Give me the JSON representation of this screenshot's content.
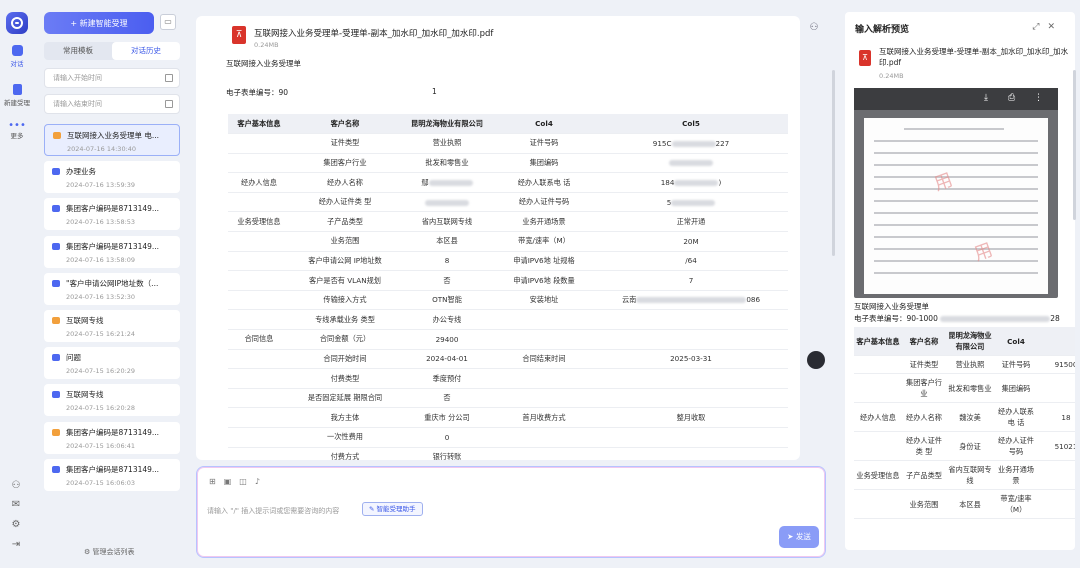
{
  "rail": {
    "items": [
      {
        "label": "对话",
        "active": true
      },
      {
        "label": "新建受理",
        "active": false
      },
      {
        "label": "更多",
        "active": false
      }
    ]
  },
  "sidebar": {
    "new_button": "+ 新建智能受理",
    "tabs": [
      {
        "label": "常用模板",
        "active": false
      },
      {
        "label": "对话历史",
        "active": true
      }
    ],
    "start_date_placeholder": "请输入开始时间",
    "end_date_placeholder": "请输入结束时间",
    "history": [
      {
        "title": "互联网接入业务受理单 电...",
        "date": "2024-07-16 14:30:40",
        "icon": "orange",
        "active": true
      },
      {
        "title": "办理业务",
        "date": "2024-07-16 13:59:39",
        "icon": "blue",
        "active": false
      },
      {
        "title": "集团客户编码是8713149...",
        "date": "2024-07-16 13:58:53",
        "icon": "blue",
        "active": false
      },
      {
        "title": "集团客户编码是8713149...",
        "date": "2024-07-16 13:58:09",
        "icon": "blue",
        "active": false
      },
      {
        "title": "\"客户申请公网IP地址数（...",
        "date": "2024-07-16 13:52:30",
        "icon": "blue",
        "active": false
      },
      {
        "title": "互联网专线",
        "date": "2024-07-15 16:21:24",
        "icon": "orange",
        "active": false
      },
      {
        "title": "问题",
        "date": "2024-07-15 16:20:29",
        "icon": "blue",
        "active": false
      },
      {
        "title": "互联网专线",
        "date": "2024-07-15 16:20:28",
        "icon": "blue",
        "active": false
      },
      {
        "title": "集团客户编码是8713149...",
        "date": "2024-07-15 16:06:41",
        "icon": "orange",
        "active": false
      },
      {
        "title": "集团客户编码是8713149...",
        "date": "2024-07-15 16:06:03",
        "icon": "blue",
        "active": false
      }
    ],
    "manage_label": "管理会话列表"
  },
  "main": {
    "file_name": "互联网接入业务受理单-受理单-副本_加水印_加水印_加水印.pdf",
    "file_size": "0.24MB",
    "doc_title": "互联网接入业务受理单",
    "doc_no": "电子表单编号：90",
    "doc_no_suffix": "1",
    "table_headers": [
      "客户基本信息",
      "客户名称",
      "昆明龙海物业有限公司",
      "Col4",
      "Col5"
    ],
    "rows": [
      [
        "",
        "证件类型",
        "营业执照",
        "证件号码",
        "915C|227"
      ],
      [
        "",
        "集团客户行业",
        "批发和零售业",
        "集团编码",
        "|"
      ],
      [
        "经办人信息",
        "经办人名称",
        "鄢|",
        "经办人联系电 话",
        "184|)"
      ],
      [
        "",
        "经办人证件类 型",
        "|",
        "经办人证件号码",
        "5|"
      ],
      [
        "业务受理信息",
        "子产品类型",
        "省内互联网专线",
        "业务开通场景",
        "正常开通"
      ],
      [
        "",
        "业务范围",
        "本区县",
        "带宽/速率（M）",
        "20M"
      ],
      [
        "",
        "客户申请公网 IP地址数",
        "8",
        "申请IPV6地 址规格",
        "/64"
      ],
      [
        "",
        "客户是否有 VLAN规划",
        "否",
        "申请IPV6地 段数量",
        "7"
      ],
      [
        "",
        "传输接入方式",
        "OTN智能",
        "安装地址",
        "云南|086"
      ],
      [
        "",
        "专线承载业务 类型",
        "办公专线",
        "",
        ""
      ],
      [
        "合同信息",
        "合同金额（元）",
        "29400",
        "",
        ""
      ],
      [
        "",
        "合同开始时间",
        "2024-04-01",
        "合同结束时间",
        "2025-03-31"
      ],
      [
        "",
        "付费类型",
        "季度预付",
        "",
        ""
      ],
      [
        "",
        "是否固定延展 期限合同",
        "否",
        "",
        ""
      ],
      [
        "",
        "我方主体",
        "重庆市 分公司",
        "首月收费方式",
        "整月收取"
      ],
      [
        "",
        "一次性费用",
        "0",
        "",
        ""
      ],
      [
        "",
        "付费方式",
        "银行转账",
        "",
        ""
      ]
    ]
  },
  "input": {
    "placeholder": "请输入 \"/\" 插入提示词或您需要咨询的内容",
    "chip": "智能受理助手",
    "send": "发送"
  },
  "panel": {
    "title": "输入解析预览",
    "file_name": "互联网接入业务受理单-受理单-副本_加水印_加水印_加水印.pdf",
    "file_size": "0.24MB",
    "doc_title": "互联网接入业务受理单",
    "doc_no": "电子表单编号：90-1000",
    "doc_no_suffix": "28",
    "table_headers": [
      "客户基本信息",
      "客户名称",
      "昆明龙海物业有限公司",
      "Col4",
      ""
    ],
    "rows": [
      [
        "",
        "证件类型",
        "营业执照",
        "证件号码",
        "91500"
      ],
      [
        "",
        "集团客户行业",
        "批发和零售业",
        "集团编码",
        ""
      ],
      [
        "经办人信息",
        "经办人名称",
        "魏汝美",
        "经办人联系电 话",
        "18"
      ],
      [
        "",
        "经办人证件类 型",
        "身份证",
        "经办人证件号码",
        "51021"
      ],
      [
        "业务受理信息",
        "子产品类型",
        "省内互联网专线",
        "业务开通场景",
        ""
      ],
      [
        "",
        "业务范围",
        "本区县",
        "带宽/速率（M）",
        ""
      ]
    ]
  }
}
